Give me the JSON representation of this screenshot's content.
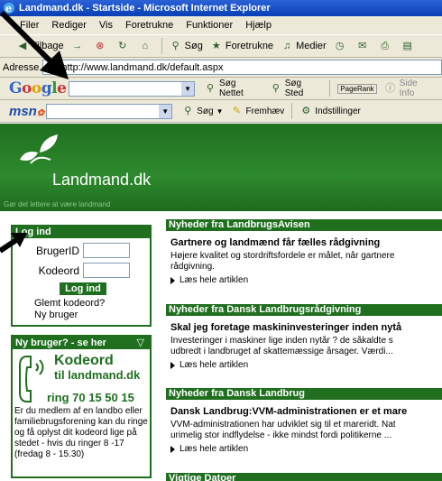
{
  "window": {
    "title": "Landmand.dk - Startside - Microsoft Internet Explorer"
  },
  "menu": [
    "Filer",
    "Rediger",
    "Vis",
    "Foretrukne",
    "Funktioner",
    "Hjælp"
  ],
  "toolbar": {
    "back": "Tilbage",
    "search": "Søg",
    "favorites": "Foretrukne",
    "media": "Medier"
  },
  "address": {
    "label": "Adresse",
    "url": "http://www.landmand.dk/default.aspx"
  },
  "google_bar": {
    "logo": "Google",
    "search_web": "Søg Nettet",
    "search_site": "Søg Sted",
    "pagerank": "PageRank",
    "page_info": "Side Info"
  },
  "msn_bar": {
    "logo": "msn",
    "search": "Søg",
    "highlight": "Fremhæv",
    "settings": "Indstillinger"
  },
  "site": {
    "name": "Landmand.dk",
    "tagline": "Gør det lettere at være landmand"
  },
  "login": {
    "heading": "Log ind",
    "user_label": "BrugerID",
    "password_label": "Kodeord",
    "button": "Log ind",
    "forgot": "Glemt kodeord?",
    "new_user": "Ny bruger"
  },
  "new_user_box": {
    "heading": "Ny bruger? - se her",
    "kodeord": "Kodeord",
    "to": "til landmand.dk",
    "phone": "ring 70 15 50 15",
    "text": "Er du medlem af en landbo eller familiebrugsforening kan du ringe og få oplyst dit kodeord lige på stedet - hvis du ringer 8 -17 (fredag 8 - 15.30)"
  },
  "news": [
    {
      "heading": "Nyheder fra LandbrugsAvisen",
      "title": "Gartnere og landmænd får fælles rådgivning",
      "body_lines": [
        "Højere kvalitet og stordriftsfordele er målet, når gartnere",
        "rådgivning."
      ],
      "more": "Læs hele artiklen"
    },
    {
      "heading": "Nyheder fra Dansk Landbrugsrådgivning",
      "title": "Skal jeg foretage maskininvesteringer inden nytå",
      "body_lines": [
        "Investeringer i maskiner lige inden nytår ? de såkaldte s",
        "udbredt i landbruget af skattemæssige årsager. Værdi..."
      ],
      "more": "Læs hele artiklen"
    },
    {
      "heading": "Nyheder fra Dansk Landbrug",
      "title": "Dansk Landbrug:VVM-administrationen er et mare",
      "body_lines": [
        "VVM-administrationen har udviklet sig til et mareridt. Nat",
        "urimelig stor indflydelse - ikke mindst fordi politikerne ..."
      ],
      "more": "Læs hele artiklen"
    },
    {
      "heading": "Vigtige Datoer"
    }
  ]
}
